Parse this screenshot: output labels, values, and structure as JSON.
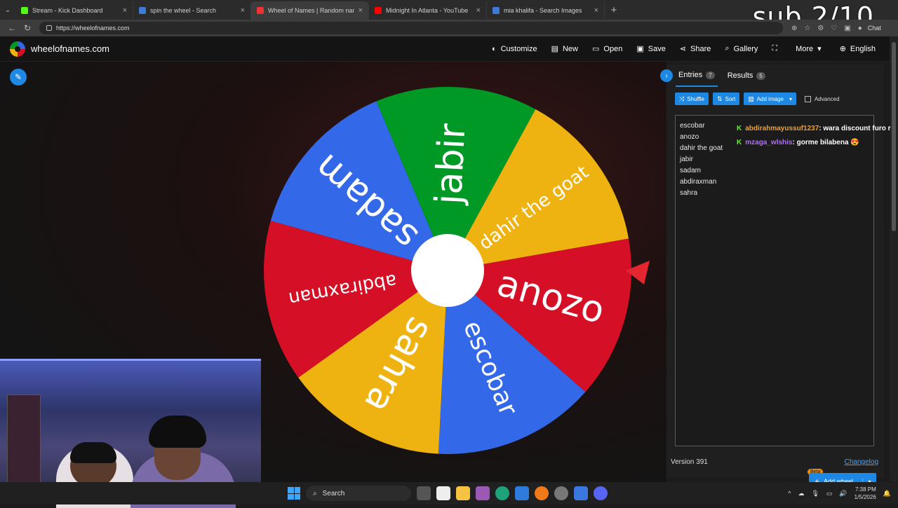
{
  "browser": {
    "tabs": [
      {
        "label": "Stream - Kick Dashboard",
        "icon": "kick-icon",
        "color": "#53fc18"
      },
      {
        "label": "spin the wheel - Search",
        "icon": "search-icon",
        "color": "#3e7bd6"
      },
      {
        "label": "Wheel of Names | Random name p",
        "icon": "wheel-icon",
        "color": "#e33"
      },
      {
        "label": "Midnight In Atlanta - YouTube",
        "icon": "youtube-icon",
        "color": "#f00"
      },
      {
        "label": "mia khalifa - Search Images",
        "icon": "search-icon",
        "color": "#3e7bd6"
      }
    ],
    "url": "https://wheelofnames.com",
    "chat_label": "Chat"
  },
  "overlay": {
    "sub_counter": "sub 2/10"
  },
  "site": {
    "logo_text": "wheelofnames.com",
    "nav": [
      {
        "label": "Customize",
        "icon": "palette-icon"
      },
      {
        "label": "New",
        "icon": "file-icon"
      },
      {
        "label": "Open",
        "icon": "folder-icon"
      },
      {
        "label": "Save",
        "icon": "save-icon"
      },
      {
        "label": "Share",
        "icon": "share-icon"
      },
      {
        "label": "Gallery",
        "icon": "search-icon"
      },
      {
        "label": "",
        "icon": "fullscreen-icon"
      },
      {
        "label": "More",
        "icon": "chevron-down-icon"
      },
      {
        "label": "English",
        "icon": "globe-icon"
      }
    ]
  },
  "wheel": {
    "segments": [
      {
        "label": "jabir",
        "color": "#009925"
      },
      {
        "label": "dahir the goat",
        "color": "#eeb211"
      },
      {
        "label": "anozo",
        "color": "#d50f25"
      },
      {
        "label": "escobar",
        "color": "#3369e8"
      },
      {
        "label": "sahra",
        "color": "#eeb211"
      },
      {
        "label": "abdiraxman",
        "color": "#d50f25"
      },
      {
        "label": "sadam",
        "color": "#3369e8"
      }
    ],
    "pointer_color": "#e3262f"
  },
  "panel": {
    "tab_entries": "Entries",
    "entries_count": "7",
    "tab_results": "Results",
    "results_count": "5",
    "shuffle": "Shuffle",
    "sort": "Sort",
    "add_image": "Add image",
    "advanced": "Advanced",
    "entries": [
      "escobar",
      "anozo",
      "dahir the goat",
      "jabir",
      "sadam",
      "abdiraxman",
      "sahra"
    ],
    "beta": "Beta",
    "add_wheel": "Add wheel",
    "version": "Version 391",
    "changelog": "Changelog"
  },
  "chat": [
    {
      "user": "abdirahmayussuf1237",
      "user_color": "#f0a030",
      "message": ": wara discount furo r"
    },
    {
      "user": "mzaga_wlshis",
      "user_color": "#b36cff",
      "message": ": gorme bilabena 😍"
    }
  ],
  "taskbar": {
    "search_label": "Search",
    "time": "7:38 PM",
    "date": "1/5/2026"
  }
}
